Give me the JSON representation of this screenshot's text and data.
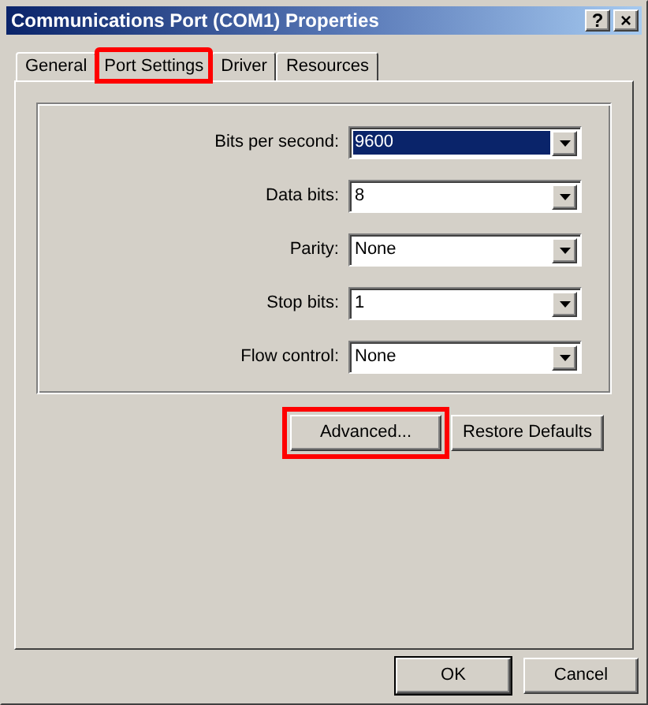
{
  "window": {
    "title": "Communications Port (COM1) Properties",
    "title_buttons": [
      "?",
      "×"
    ]
  },
  "tabs": [
    {
      "label": "General",
      "selected": false,
      "highlighted": false
    },
    {
      "label": "Port Settings",
      "selected": true,
      "highlighted": true
    },
    {
      "label": "Driver",
      "selected": false,
      "highlighted": false
    },
    {
      "label": "Resources",
      "selected": false,
      "highlighted": false
    }
  ],
  "settings": [
    {
      "label": "Bits per second:",
      "value": "9600",
      "focused": true
    },
    {
      "label": "Data bits:",
      "value": "8",
      "focused": false
    },
    {
      "label": "Parity:",
      "value": "None",
      "focused": false
    },
    {
      "label": "Stop bits:",
      "value": "1",
      "focused": false
    },
    {
      "label": "Flow control:",
      "value": "None",
      "focused": false
    }
  ],
  "panel_buttons": [
    {
      "label": "Advanced...",
      "highlighted": true
    },
    {
      "label": "Restore Defaults",
      "highlighted": false
    }
  ],
  "dialog_buttons": [
    "OK",
    "Cancel"
  ]
}
